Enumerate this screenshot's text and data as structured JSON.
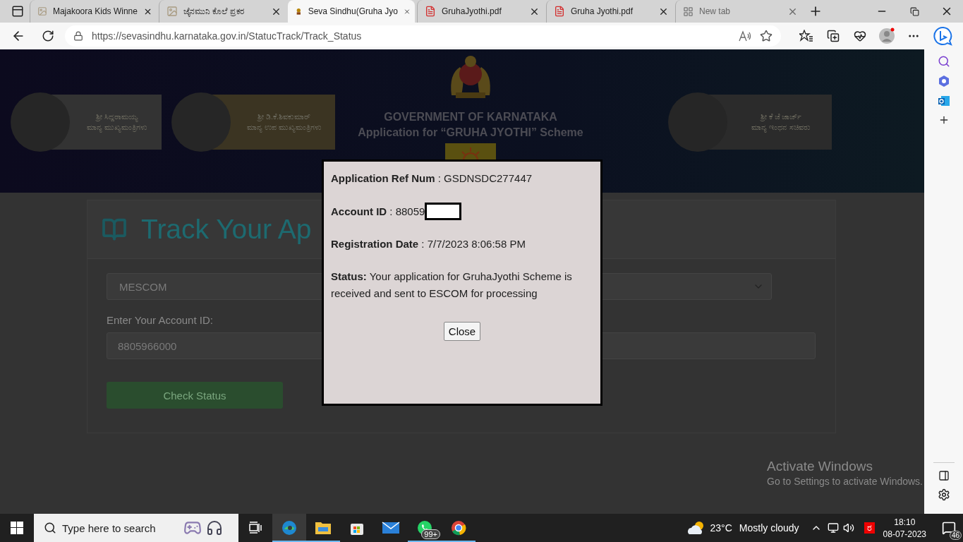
{
  "browser": {
    "tabs": [
      {
        "title": "Majakoora Kids Winne",
        "kind": "image",
        "selected": false
      },
      {
        "title": "ಜೈನಮುನಿ ಕೊಲೆ ಪ್ರಕರ",
        "kind": "image",
        "selected": false
      },
      {
        "title": "Seva Sindhu(Gruha Jyo",
        "kind": "emblem",
        "selected": true
      },
      {
        "title": "GruhaJyothi.pdf",
        "kind": "pdf",
        "selected": false
      },
      {
        "title": "Gruha Jyothi.pdf",
        "kind": "pdf",
        "selected": false
      },
      {
        "title": "New tab",
        "kind": "newtab",
        "selected": false
      }
    ],
    "address": "https://sevasindhu.karnataka.gov.in/StatucTrack/Track_Status"
  },
  "banner": {
    "leaders": [
      {
        "name": "ಶ್ರೀ ಸಿದ್ದರಾಮಯ್ಯ",
        "role": "ಮಾನ್ಯ ಮುಖ್ಯಮಂತ್ರಿಗಳು",
        "color": "#333333"
      },
      {
        "name": "ಶ್ರೀ ಡಿ.ಕೆ.ಶಿವಕುಮಾರ್",
        "role": "ಮಾನ್ಯ ಉಪ ಮುಖ್ಯಮಂತ್ರಿಗಳು",
        "color": "#3b3422"
      },
      {
        "name": "ಶ್ರೀ ಕೆ ಜೆ ಜಾರ್ಜ್",
        "role": "ಮಾನ್ಯ ಇಂಧನ ಸಚಿವರು",
        "color": "#2b2b2b"
      }
    ],
    "title": "GOVERNMENT OF KARNATAKA",
    "subtitle": "Application for “GRUHA JYOTHI” Scheme"
  },
  "form": {
    "heading": "Track Your Ap",
    "escom": "MESCOM",
    "account_label": "Enter Your Account ID:",
    "account_value": "8805966000",
    "button": "Check Status"
  },
  "dialog": {
    "rows": [
      {
        "text": "**Application Ref Num** : GSDNSDC277447",
        "redacted": false
      },
      {
        "text": "**Account ID** : 88059",
        "redacted": true
      },
      {
        "text": "**Registration Date** : 7/7/2023 8:06:58 PM",
        "redacted": false
      },
      {
        "text": "**Status:** Your application for GruhaJyothi Scheme is received and sent to ESCOM for processing",
        "redacted": false
      }
    ],
    "button": "Close"
  },
  "watermark": {
    "title": "Activate Windows",
    "text": "Go to Settings to activate Windows."
  },
  "taskbar": {
    "search_placeholder": "Type here to search",
    "apps": [
      {
        "kind": "taskview",
        "selected": false,
        "running": false
      },
      {
        "kind": "edge",
        "selected": true,
        "running": true
      },
      {
        "kind": "explorer",
        "selected": false,
        "running": true
      },
      {
        "kind": "store",
        "selected": false,
        "running": false
      },
      {
        "kind": "mail",
        "selected": false,
        "running": false
      },
      {
        "kind": "whatsapp",
        "selected": false,
        "running": true,
        "badge": "99+"
      },
      {
        "kind": "chrome",
        "selected": false,
        "running": true
      }
    ],
    "temperature": "23°C",
    "weather": "Mostly cloudy",
    "ime": "ರ",
    "time": "18:10",
    "date": "08-07-2023",
    "notifications": "46"
  }
}
